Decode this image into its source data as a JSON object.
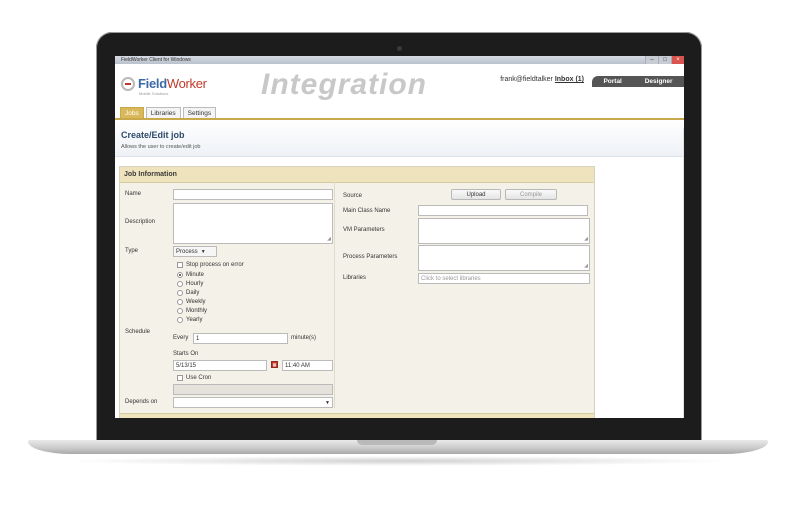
{
  "window": {
    "title": "FieldWorker Client for Windows",
    "controls": {
      "minimize": "–",
      "maximize": "□",
      "close": "×"
    }
  },
  "header": {
    "logo_text": "Field",
    "logo_text_accent": "Worker",
    "logo_sub": "Mobile Solutions",
    "page_heading": "Integration",
    "user": "frank@fieldtalker",
    "inbox": "Inbox (1)",
    "top_tabs": [
      "Portal",
      "Designer"
    ]
  },
  "nav_tabs": [
    {
      "label": "Jobs",
      "active": true
    },
    {
      "label": "Libraries",
      "active": false
    },
    {
      "label": "Settings",
      "active": false
    }
  ],
  "page": {
    "title": "Create/Edit job",
    "description": "Allows the user to create/edit job"
  },
  "form": {
    "section_title": "Job Information",
    "name_label": "Name",
    "name_value": "",
    "description_label": "Description",
    "type_label": "Type",
    "type_value": "Process",
    "stop_on_error_label": "Stop process on error",
    "schedule_label": "Schedule",
    "schedule_options": [
      "Minute",
      "Hourly",
      "Daily",
      "Weekly",
      "Monthly",
      "Yearly"
    ],
    "schedule_selected": "Minute",
    "every_label": "Every",
    "every_value": "1",
    "every_unit": "minute(s)",
    "starts_on_label": "Starts On",
    "start_date": "5/13/15",
    "start_time": "11:40 AM",
    "use_cron_label": "Use Cron",
    "depends_on_label": "Depends on",
    "source_label": "Source",
    "upload_label": "Upload",
    "compile_label": "Compile",
    "main_class_label": "Main Class Name",
    "vm_params_label": "VM Parameters",
    "process_params_label": "Process Parameters",
    "libraries_label": "Libraries",
    "libraries_placeholder": "Click to select libraries"
  },
  "colors": {
    "accent_gold": "#c9a84c",
    "panel_header": "#eee3bd",
    "title_blue": "#2d4b6b",
    "logo_blue": "#3b6aa8",
    "logo_red": "#c0392b"
  }
}
